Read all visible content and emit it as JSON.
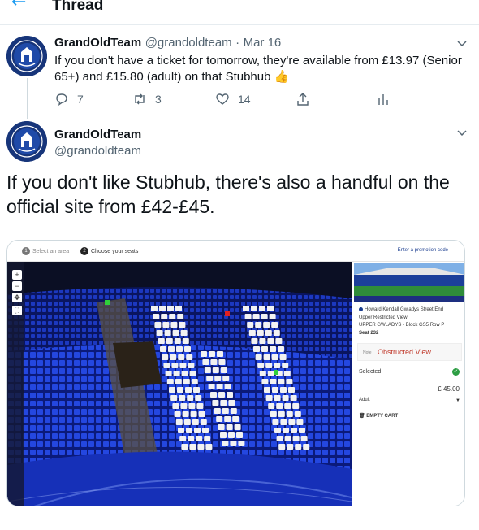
{
  "header": {
    "back_icon": "arrow-left-icon",
    "title": "Thread"
  },
  "tweet1": {
    "name": "GrandOldTeam",
    "handle": "@grandoldteam",
    "separator": "·",
    "date": "Mar 16",
    "text": "If you don't have a ticket for tomorrow, they're available from £13.97 (Senior 65+) and £15.80 (adult) on that Stubhub 👍",
    "replies": "7",
    "retweets": "3",
    "likes": "14"
  },
  "tweet2": {
    "name": "GrandOldTeam",
    "handle": "@grandoldteam",
    "text": "If you don't like Stubhub, there's also a handful on the official site from £42-£45."
  },
  "ticket_site": {
    "step1_num": "1",
    "step1": "Select an area",
    "step2_num": "2",
    "step2": "Choose your seats",
    "promo": "Enter a promotion code",
    "stand": "Howard Kendall Gwladys Street End",
    "view": "Upper Restricted View",
    "block": "UPPER GWLADYS - Block GS5 Row P",
    "seat": "Seat 232",
    "obstructed_note": "Note",
    "obstructed": "Obstructed View",
    "selected": "Selected",
    "price": "£ 45.00",
    "ticket_type": "Adult",
    "empty_cart": "EMPTY CART"
  },
  "colors": {
    "accent": "#1d9bf0",
    "seat_blue": "#1f3fd6",
    "seat_white": "#f4f4f4",
    "obstructed_red": "#c0392b"
  }
}
